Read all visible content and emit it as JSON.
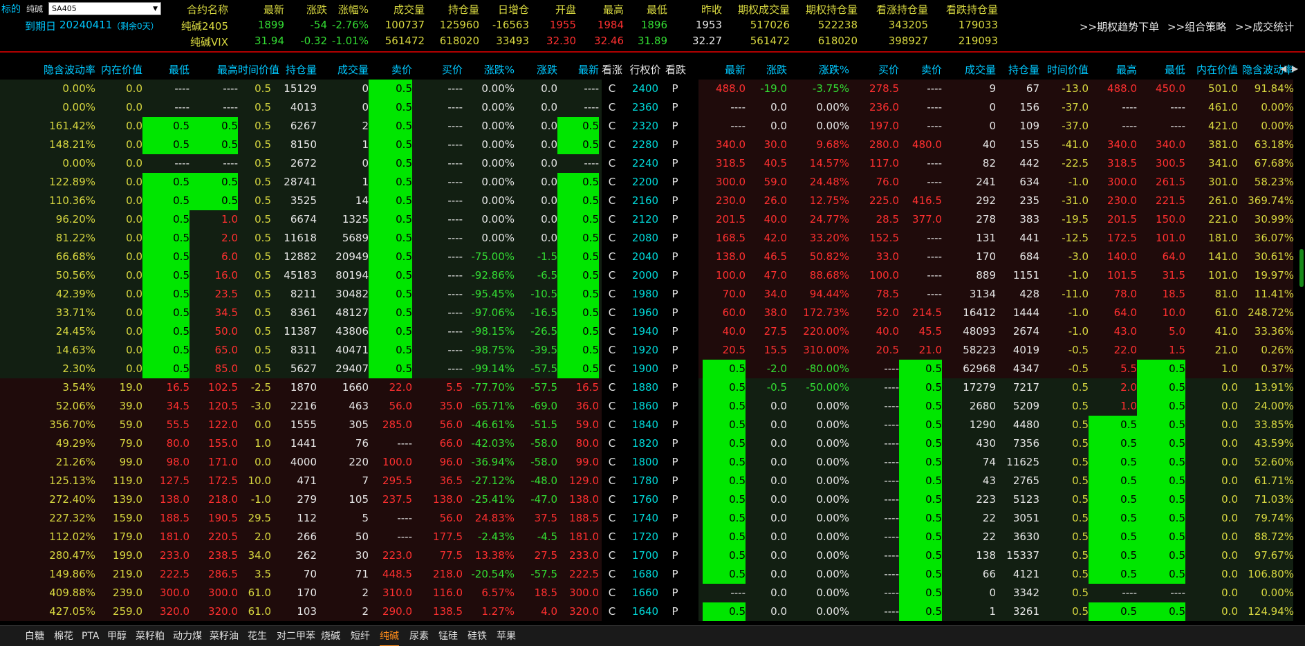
{
  "top": {
    "label_biaodi": "标的",
    "label_product": "纯碱",
    "select_value": "SA405",
    "label_expiry": "到期日",
    "expiry_date": "20240411",
    "expiry_note": "（剩余0天）",
    "headers": [
      "合约名称",
      "最新",
      "涨跌",
      "涨幅%",
      "成交量",
      "持仓量",
      "日增仓",
      "开盘",
      "最高",
      "最低",
      "昨收",
      "期权成交量",
      "期权持仓量",
      "看涨持仓量",
      "看跌持仓量"
    ],
    "row1": [
      "纯碱2405",
      "1899",
      "-54",
      "-2.76%",
      "100737",
      "125960",
      "-16563",
      "1955",
      "1984",
      "1896",
      "1953",
      "517026",
      "522238",
      "343205",
      "179033"
    ],
    "row2": [
      "纯碱VIX",
      "31.94",
      "-0.32",
      "-1.01%",
      "561472",
      "618020",
      "33493",
      "32.30",
      "32.46",
      "31.89",
      "32.27",
      "561472",
      "618020",
      "398927",
      "219093"
    ],
    "links": [
      ">>期权趋势下单",
      ">>组合策略",
      ">>成交统计"
    ]
  },
  "headers": [
    "隐含波动率",
    "内在价值",
    "最低",
    "最高",
    "时间价值",
    "持仓量",
    "成交量",
    "卖价",
    "买价",
    "涨跌%",
    "涨跌",
    "最新",
    "看涨",
    "行权价",
    "看跌",
    "最新",
    "涨跌",
    "涨跌%",
    "买价",
    "卖价",
    "成交量",
    "持仓量",
    "时间价值",
    "最高",
    "最低",
    "内在价值",
    "隐含波动率"
  ],
  "rows": [
    [
      "0.00%",
      "0.0",
      "----",
      "----",
      "0.5",
      "15129",
      "0",
      "0.5",
      "----",
      "0.00%",
      "0.0",
      "----",
      "C",
      "2400",
      "P",
      "488.0",
      "-19.0",
      "-3.75%",
      "278.5",
      "----",
      "9",
      "67",
      "-13.0",
      "488.0",
      "450.0",
      "501.0",
      "91.84%"
    ],
    [
      "0.00%",
      "0.0",
      "----",
      "----",
      "0.5",
      "4013",
      "0",
      "0.5",
      "----",
      "0.00%",
      "0.0",
      "----",
      "C",
      "2360",
      "P",
      "----",
      "0.0",
      "0.00%",
      "236.0",
      "----",
      "0",
      "156",
      "-37.0",
      "----",
      "----",
      "461.0",
      "0.00%"
    ],
    [
      "161.42%",
      "0.0",
      "0.5",
      "0.5",
      "0.5",
      "6267",
      "2",
      "0.5",
      "----",
      "0.00%",
      "0.0",
      "0.5",
      "C",
      "2320",
      "P",
      "----",
      "0.0",
      "0.00%",
      "197.0",
      "----",
      "0",
      "109",
      "-37.0",
      "----",
      "----",
      "421.0",
      "0.00%"
    ],
    [
      "148.21%",
      "0.0",
      "0.5",
      "0.5",
      "0.5",
      "8150",
      "1",
      "0.5",
      "----",
      "0.00%",
      "0.0",
      "0.5",
      "C",
      "2280",
      "P",
      "340.0",
      "30.0",
      "9.68%",
      "280.0",
      "480.0",
      "40",
      "155",
      "-41.0",
      "340.0",
      "340.0",
      "381.0",
      "63.18%"
    ],
    [
      "0.00%",
      "0.0",
      "----",
      "----",
      "0.5",
      "2672",
      "0",
      "0.5",
      "----",
      "0.00%",
      "0.0",
      "----",
      "C",
      "2240",
      "P",
      "318.5",
      "40.5",
      "14.57%",
      "117.0",
      "----",
      "82",
      "442",
      "-22.5",
      "318.5",
      "300.5",
      "341.0",
      "67.68%"
    ],
    [
      "122.89%",
      "0.0",
      "0.5",
      "0.5",
      "0.5",
      "28741",
      "1",
      "0.5",
      "----",
      "0.00%",
      "0.0",
      "0.5",
      "C",
      "2200",
      "P",
      "300.0",
      "59.0",
      "24.48%",
      "76.0",
      "----",
      "241",
      "634",
      "-1.0",
      "300.0",
      "261.5",
      "301.0",
      "58.23%"
    ],
    [
      "110.36%",
      "0.0",
      "0.5",
      "0.5",
      "0.5",
      "3525",
      "14",
      "0.5",
      "----",
      "0.00%",
      "0.0",
      "0.5",
      "C",
      "2160",
      "P",
      "230.0",
      "26.0",
      "12.75%",
      "225.0",
      "416.5",
      "292",
      "235",
      "-31.0",
      "230.0",
      "221.5",
      "261.0",
      "369.74%"
    ],
    [
      "96.20%",
      "0.0",
      "0.5",
      "1.0",
      "0.5",
      "6674",
      "1325",
      "0.5",
      "----",
      "0.00%",
      "0.0",
      "0.5",
      "C",
      "2120",
      "P",
      "201.5",
      "40.0",
      "24.77%",
      "28.5",
      "377.0",
      "278",
      "383",
      "-19.5",
      "201.5",
      "150.0",
      "221.0",
      "30.99%"
    ],
    [
      "81.22%",
      "0.0",
      "0.5",
      "2.0",
      "0.5",
      "11618",
      "5689",
      "0.5",
      "----",
      "0.00%",
      "0.0",
      "0.5",
      "C",
      "2080",
      "P",
      "168.5",
      "42.0",
      "33.20%",
      "152.5",
      "----",
      "131",
      "441",
      "-12.5",
      "172.5",
      "101.0",
      "181.0",
      "36.07%"
    ],
    [
      "66.68%",
      "0.0",
      "0.5",
      "6.0",
      "0.5",
      "12882",
      "20949",
      "0.5",
      "----",
      "-75.00%",
      "-1.5",
      "0.5",
      "C",
      "2040",
      "P",
      "138.0",
      "46.5",
      "50.82%",
      "33.0",
      "----",
      "170",
      "684",
      "-3.0",
      "140.0",
      "64.0",
      "141.0",
      "30.61%"
    ],
    [
      "50.56%",
      "0.0",
      "0.5",
      "16.0",
      "0.5",
      "45183",
      "80194",
      "0.5",
      "----",
      "-92.86%",
      "-6.5",
      "0.5",
      "C",
      "2000",
      "P",
      "100.0",
      "47.0",
      "88.68%",
      "100.0",
      "----",
      "889",
      "1151",
      "-1.0",
      "101.5",
      "31.5",
      "101.0",
      "19.97%"
    ],
    [
      "42.39%",
      "0.0",
      "0.5",
      "23.5",
      "0.5",
      "8211",
      "30482",
      "0.5",
      "----",
      "-95.45%",
      "-10.5",
      "0.5",
      "C",
      "1980",
      "P",
      "70.0",
      "34.0",
      "94.44%",
      "78.5",
      "----",
      "3134",
      "428",
      "-11.0",
      "78.0",
      "18.5",
      "81.0",
      "11.41%"
    ],
    [
      "33.71%",
      "0.0",
      "0.5",
      "34.5",
      "0.5",
      "8361",
      "48127",
      "0.5",
      "----",
      "-97.06%",
      "-16.5",
      "0.5",
      "C",
      "1960",
      "P",
      "60.0",
      "38.0",
      "172.73%",
      "52.0",
      "214.5",
      "16412",
      "1444",
      "-1.0",
      "64.0",
      "10.0",
      "61.0",
      "248.72%"
    ],
    [
      "24.45%",
      "0.0",
      "0.5",
      "50.0",
      "0.5",
      "11387",
      "43806",
      "0.5",
      "----",
      "-98.15%",
      "-26.5",
      "0.5",
      "C",
      "1940",
      "P",
      "40.0",
      "27.5",
      "220.00%",
      "40.0",
      "45.5",
      "48093",
      "2674",
      "-1.0",
      "43.0",
      "5.0",
      "41.0",
      "33.36%"
    ],
    [
      "14.63%",
      "0.0",
      "0.5",
      "65.0",
      "0.5",
      "8311",
      "40471",
      "0.5",
      "----",
      "-98.75%",
      "-39.5",
      "0.5",
      "C",
      "1920",
      "P",
      "20.5",
      "15.5",
      "310.00%",
      "20.5",
      "21.0",
      "58223",
      "4019",
      "-0.5",
      "22.0",
      "1.5",
      "21.0",
      "0.26%"
    ],
    [
      "2.30%",
      "0.0",
      "0.5",
      "85.0",
      "0.5",
      "5627",
      "29407",
      "0.5",
      "----",
      "-99.14%",
      "-57.5",
      "0.5",
      "C",
      "1900",
      "P",
      "0.5",
      "-2.0",
      "-80.00%",
      "----",
      "0.5",
      "62968",
      "4347",
      "-0.5",
      "5.5",
      "0.5",
      "1.0",
      "0.37%"
    ],
    [
      "3.54%",
      "19.0",
      "16.5",
      "102.5",
      "-2.5",
      "1870",
      "1660",
      "22.0",
      "5.5",
      "-77.70%",
      "-57.5",
      "16.5",
      "C",
      "1880",
      "P",
      "0.5",
      "-0.5",
      "-50.00%",
      "----",
      "0.5",
      "17279",
      "7217",
      "0.5",
      "2.0",
      "0.5",
      "0.0",
      "13.91%"
    ],
    [
      "52.06%",
      "39.0",
      "34.5",
      "120.5",
      "-3.0",
      "2216",
      "463",
      "56.0",
      "35.0",
      "-65.71%",
      "-69.0",
      "36.0",
      "C",
      "1860",
      "P",
      "0.5",
      "0.0",
      "0.00%",
      "----",
      "0.5",
      "2680",
      "5209",
      "0.5",
      "1.0",
      "0.5",
      "0.0",
      "24.00%"
    ],
    [
      "356.70%",
      "59.0",
      "55.5",
      "122.0",
      "0.0",
      "1555",
      "305",
      "285.0",
      "56.0",
      "-46.61%",
      "-51.5",
      "59.0",
      "C",
      "1840",
      "P",
      "0.5",
      "0.0",
      "0.00%",
      "----",
      "0.5",
      "1290",
      "4480",
      "0.5",
      "0.5",
      "0.5",
      "0.0",
      "33.85%"
    ],
    [
      "49.29%",
      "79.0",
      "80.0",
      "155.0",
      "1.0",
      "1441",
      "76",
      "----",
      "66.0",
      "-42.03%",
      "-58.0",
      "80.0",
      "C",
      "1820",
      "P",
      "0.5",
      "0.0",
      "0.00%",
      "----",
      "0.5",
      "430",
      "7356",
      "0.5",
      "0.5",
      "0.5",
      "0.0",
      "43.59%"
    ],
    [
      "21.26%",
      "99.0",
      "98.0",
      "171.0",
      "0.0",
      "4000",
      "220",
      "100.0",
      "96.0",
      "-36.94%",
      "-58.0",
      "99.0",
      "C",
      "1800",
      "P",
      "0.5",
      "0.0",
      "0.00%",
      "----",
      "0.5",
      "74",
      "11625",
      "0.5",
      "0.5",
      "0.5",
      "0.0",
      "52.60%"
    ],
    [
      "125.13%",
      "119.0",
      "127.5",
      "172.5",
      "10.0",
      "471",
      "7",
      "295.5",
      "36.5",
      "-27.12%",
      "-48.0",
      "129.0",
      "C",
      "1780",
      "P",
      "0.5",
      "0.0",
      "0.00%",
      "----",
      "0.5",
      "43",
      "2765",
      "0.5",
      "0.5",
      "0.5",
      "0.0",
      "61.71%"
    ],
    [
      "272.40%",
      "139.0",
      "138.0",
      "218.0",
      "-1.0",
      "279",
      "105",
      "237.5",
      "138.0",
      "-25.41%",
      "-47.0",
      "138.0",
      "C",
      "1760",
      "P",
      "0.5",
      "0.0",
      "0.00%",
      "----",
      "0.5",
      "223",
      "5123",
      "0.5",
      "0.5",
      "0.5",
      "0.0",
      "71.03%"
    ],
    [
      "227.32%",
      "159.0",
      "188.5",
      "190.5",
      "29.5",
      "112",
      "5",
      "----",
      "56.0",
      "24.83%",
      "37.5",
      "188.5",
      "C",
      "1740",
      "P",
      "0.5",
      "0.0",
      "0.00%",
      "----",
      "0.5",
      "22",
      "3051",
      "0.5",
      "0.5",
      "0.5",
      "0.0",
      "79.74%"
    ],
    [
      "112.02%",
      "179.0",
      "181.0",
      "220.5",
      "2.0",
      "266",
      "50",
      "----",
      "177.5",
      "-2.43%",
      "-4.5",
      "181.0",
      "C",
      "1720",
      "P",
      "0.5",
      "0.0",
      "0.00%",
      "----",
      "0.5",
      "22",
      "3630",
      "0.5",
      "0.5",
      "0.5",
      "0.0",
      "88.72%"
    ],
    [
      "280.47%",
      "199.0",
      "233.0",
      "238.5",
      "34.0",
      "262",
      "30",
      "223.0",
      "77.5",
      "13.38%",
      "27.5",
      "233.0",
      "C",
      "1700",
      "P",
      "0.5",
      "0.0",
      "0.00%",
      "----",
      "0.5",
      "138",
      "15337",
      "0.5",
      "0.5",
      "0.5",
      "0.0",
      "97.67%"
    ],
    [
      "149.86%",
      "219.0",
      "222.5",
      "286.5",
      "3.5",
      "70",
      "71",
      "448.5",
      "218.0",
      "-20.54%",
      "-57.5",
      "222.5",
      "C",
      "1680",
      "P",
      "0.5",
      "0.0",
      "0.00%",
      "----",
      "0.5",
      "66",
      "4121",
      "0.5",
      "0.5",
      "0.5",
      "0.0",
      "106.80%"
    ],
    [
      "409.88%",
      "239.0",
      "300.0",
      "300.0",
      "61.0",
      "170",
      "2",
      "310.0",
      "116.0",
      "6.57%",
      "18.5",
      "300.0",
      "C",
      "1660",
      "P",
      "----",
      "0.0",
      "0.00%",
      "----",
      "0.5",
      "0",
      "3342",
      "0.5",
      "----",
      "----",
      "0.0",
      "0.00%"
    ],
    [
      "427.05%",
      "259.0",
      "320.0",
      "320.0",
      "61.0",
      "103",
      "2",
      "290.0",
      "138.5",
      "1.27%",
      "4.0",
      "320.0",
      "C",
      "1640",
      "P",
      "0.5",
      "0.0",
      "0.00%",
      "----",
      "0.5",
      "1",
      "3261",
      "0.5",
      "0.5",
      "0.5",
      "0.0",
      "124.94%"
    ]
  ],
  "tabs": [
    "白糖",
    "棉花",
    "PTA",
    "甲醇",
    "菜籽粕",
    "动力煤",
    "菜籽油",
    "花生",
    "对二甲苯",
    "烧碱",
    "短纤",
    "纯碱",
    "尿素",
    "锰硅",
    "硅铁",
    "苹果"
  ],
  "active_tab": "纯碱",
  "colors": {
    "highlight": "#00e600",
    "up": "#ff3030",
    "down": "#33dd33",
    "strike": "#00d8d8",
    "header": "#00c8ff"
  }
}
